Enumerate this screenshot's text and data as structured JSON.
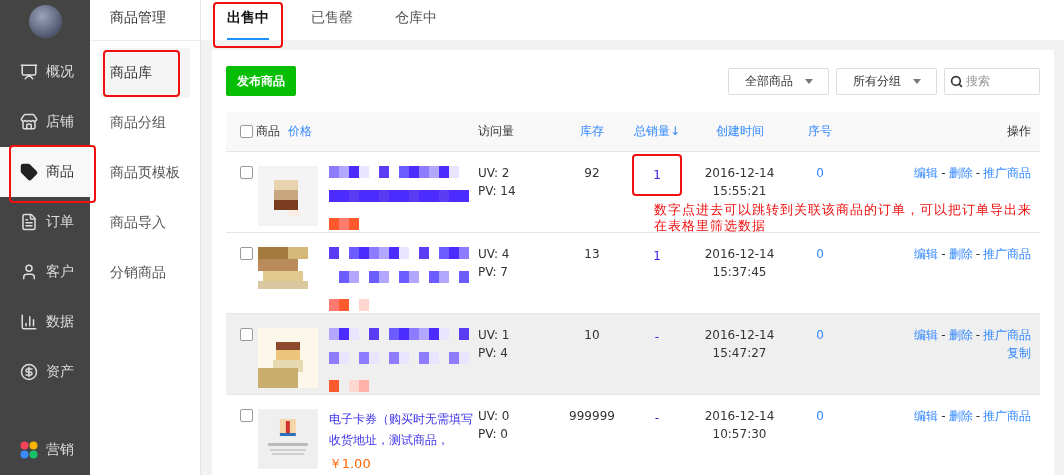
{
  "sidebar": {
    "items": [
      {
        "label": "概况",
        "selected": false,
        "highlighted": false
      },
      {
        "label": "店铺",
        "selected": false,
        "highlighted": false
      },
      {
        "label": "商品",
        "selected": true,
        "highlighted": true
      },
      {
        "label": "订单",
        "selected": false,
        "highlighted": false
      },
      {
        "label": "客户",
        "selected": false,
        "highlighted": false
      },
      {
        "label": "数据",
        "selected": false,
        "highlighted": false
      },
      {
        "label": "资产",
        "selected": false,
        "highlighted": false
      }
    ],
    "bottom_item": {
      "label": "营销"
    }
  },
  "subnav": {
    "title": "商品管理",
    "items": [
      {
        "label": "商品库",
        "selected": true,
        "highlighted": true
      },
      {
        "label": "商品分组",
        "selected": false,
        "highlighted": false
      },
      {
        "label": "商品页模板",
        "selected": false,
        "highlighted": false
      },
      {
        "label": "商品导入",
        "selected": false,
        "highlighted": false
      },
      {
        "label": "分销商品",
        "selected": false,
        "highlighted": false
      }
    ]
  },
  "tabs": [
    {
      "label": "出售中",
      "selected": true,
      "highlighted": true
    },
    {
      "label": "已售罄",
      "selected": false,
      "highlighted": false
    },
    {
      "label": "仓库中",
      "selected": false,
      "highlighted": false
    }
  ],
  "toolbar": {
    "publish_button": "发布商品",
    "filters": [
      "全部商品",
      "所有分组"
    ],
    "search": {
      "placeholder": "搜索"
    }
  },
  "table": {
    "all_checked": false,
    "columns": [
      {
        "label": "商品",
        "link": false
      },
      {
        "label": "价格",
        "link": true
      },
      {
        "label": "访问量",
        "link": false
      },
      {
        "label": "库存",
        "link": true
      },
      {
        "label": "总销量↓",
        "link": true
      },
      {
        "label": "创建时间",
        "link": true
      },
      {
        "label": "序号",
        "link": true
      },
      {
        "label": "操作",
        "link": false
      }
    ],
    "separator": "-",
    "rows": [
      {
        "kind": "pixelated",
        "checked": false,
        "uv": "UV: 2",
        "pv": "PV: 14",
        "stock": "92",
        "sales": "1",
        "sales_highlighted": true,
        "date": "2016-12-14",
        "time": "15:55:21",
        "order": "0",
        "hovered": false,
        "actions": [
          [
            "编辑",
            "删除",
            "推广商品"
          ]
        ]
      },
      {
        "kind": "pixelated",
        "checked": false,
        "uv": "UV: 4",
        "pv": "PV: 7",
        "stock": "13",
        "sales": "1",
        "sales_highlighted": false,
        "date": "2016-12-14",
        "time": "15:37:45",
        "order": "0",
        "hovered": false,
        "actions": [
          [
            "编辑",
            "删除",
            "推广商品"
          ]
        ]
      },
      {
        "kind": "pixelated",
        "checked": false,
        "uv": "UV: 1",
        "pv": "PV: 4",
        "stock": "10",
        "sales": "-",
        "sales_highlighted": false,
        "date": "2016-12-14",
        "time": "15:47:27",
        "order": "0",
        "hovered": true,
        "actions": [
          [
            "编辑",
            "删除",
            "推广商品"
          ],
          [
            "复制"
          ]
        ]
      },
      {
        "kind": "text",
        "checked": false,
        "title": "电子卡券（购买时无需填写收货地址，测试商品，",
        "price": "￥1.00",
        "uv": "UV: 0",
        "pv": "PV: 0",
        "stock": "999999",
        "sales": "-",
        "sales_highlighted": false,
        "date": "2016-12-14",
        "time": "10:57:30",
        "order": "0",
        "hovered": false,
        "actions": [
          [
            "编辑",
            "删除",
            "推广商品"
          ]
        ]
      }
    ],
    "note": "数字点进去可以跳转到关联该商品的订单，可以把订单导出来在表格里筛选数据"
  }
}
